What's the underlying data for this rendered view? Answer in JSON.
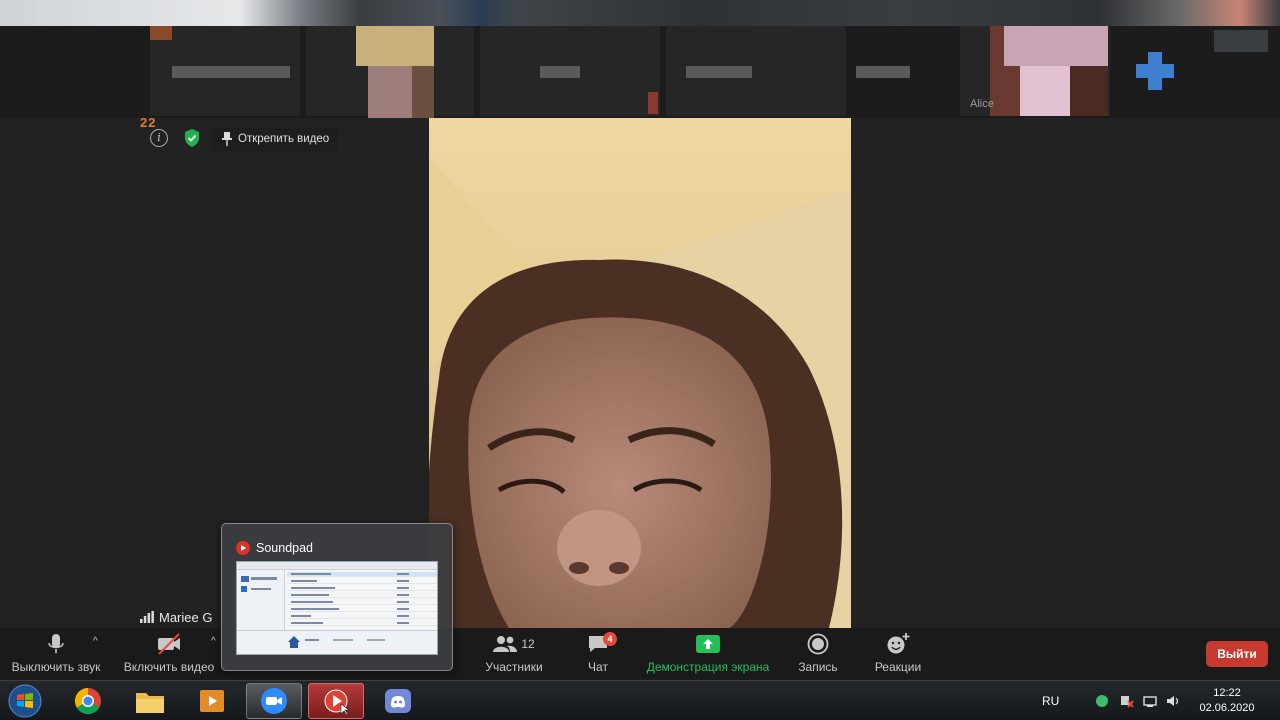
{
  "participants_strip": {
    "visible_names": [
      "Alice"
    ]
  },
  "meeting_info": {
    "participant_number": "22",
    "info_icon": "info-icon",
    "shield_icon": "shield-icon",
    "pin_label": "Открепить видео"
  },
  "main_video": {
    "participant_name": "Mariee G"
  },
  "popup": {
    "app_name": "Soundpad"
  },
  "toolbar": {
    "mute_label": "Выключить звук",
    "video_label": "Включить видео",
    "participants_label": "Участники",
    "participants_count": "12",
    "chat_label": "Чат",
    "chat_badge": "4",
    "share_label": "Демонстрация экрана",
    "record_label": "Запись",
    "reactions_label": "Реакции",
    "leave_label": "Выйти"
  },
  "taskbar": {
    "apps": [
      "chrome-icon",
      "file-explorer-icon",
      "media-player-icon",
      "zoom-icon",
      "soundpad-icon",
      "discord-icon"
    ],
    "language": "RU",
    "time": "12:22",
    "date": "02.06.2020"
  },
  "colors": {
    "share_green": "#23c05a",
    "leave_red": "#c73a2f",
    "chat_badge_red": "#e5493a",
    "toolbar_bg": "#1a1a1a"
  }
}
